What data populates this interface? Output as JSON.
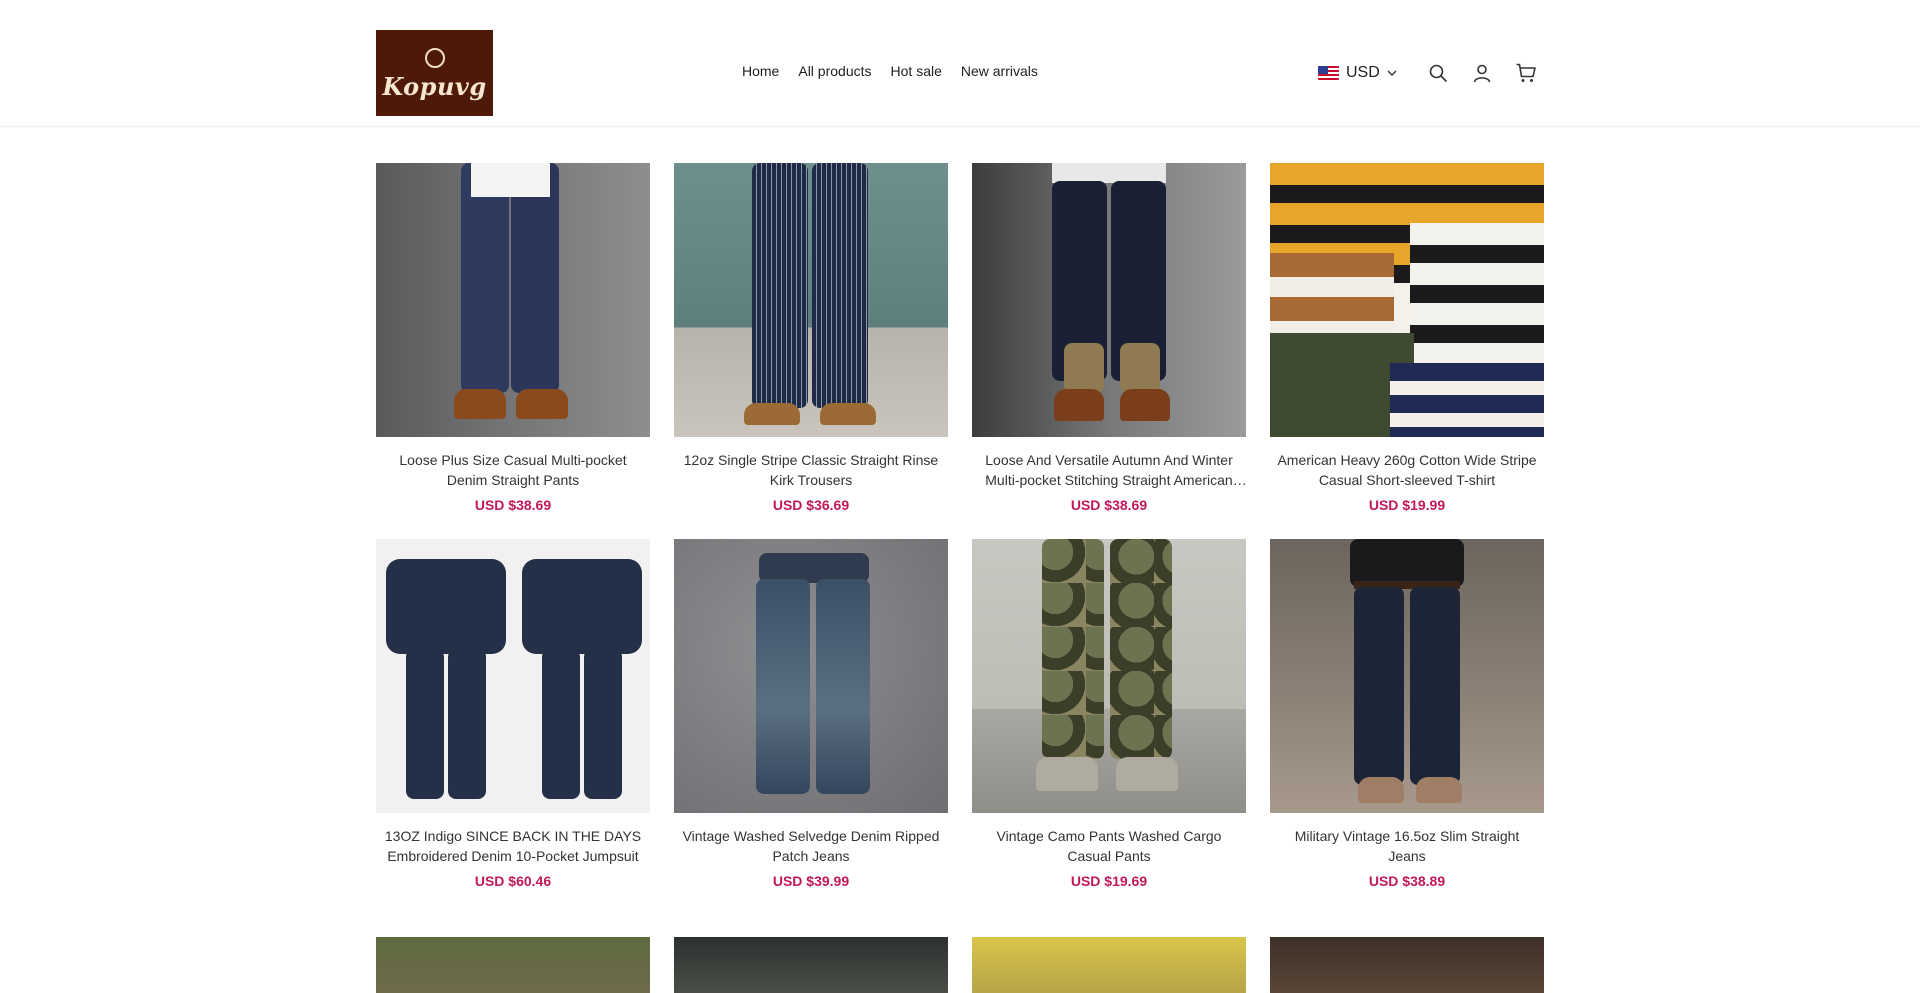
{
  "brand": {
    "logo_text": "Kopuvg"
  },
  "nav": {
    "items": [
      {
        "label": "Home"
      },
      {
        "label": "All products"
      },
      {
        "label": "Hot sale"
      },
      {
        "label": "New arrivals"
      }
    ]
  },
  "currency": {
    "selected": "USD",
    "flag": "us-flag-icon"
  },
  "products": [
    {
      "title": "Loose Plus Size Casual Multi-pocket Denim Straight Pants",
      "price": "USD $38.69"
    },
    {
      "title": "12oz Single Stripe Classic Straight Rinse Kirk Trousers",
      "price": "USD $36.69"
    },
    {
      "title": "Loose And Versatile Autumn And Winter Multi-pocket Stitching Straight American Work Pants",
      "price": "USD $38.69"
    },
    {
      "title": "American Heavy 260g Cotton Wide Stripe Casual Short-sleeved T-shirt",
      "price": "USD $19.99"
    },
    {
      "title": "13OZ Indigo SINCE BACK IN THE DAYS Embroidered Denim 10-Pocket Jumpsuit",
      "price": "USD $60.46"
    },
    {
      "title": "Vintage Washed Selvedge Denim Ripped Patch Jeans",
      "price": "USD $39.99"
    },
    {
      "title": "Vintage Camo Pants Washed Cargo Casual Pants",
      "price": "USD $19.69"
    },
    {
      "title": "Military Vintage 16.5oz Slim Straight Jeans",
      "price": "USD $38.89"
    }
  ]
}
